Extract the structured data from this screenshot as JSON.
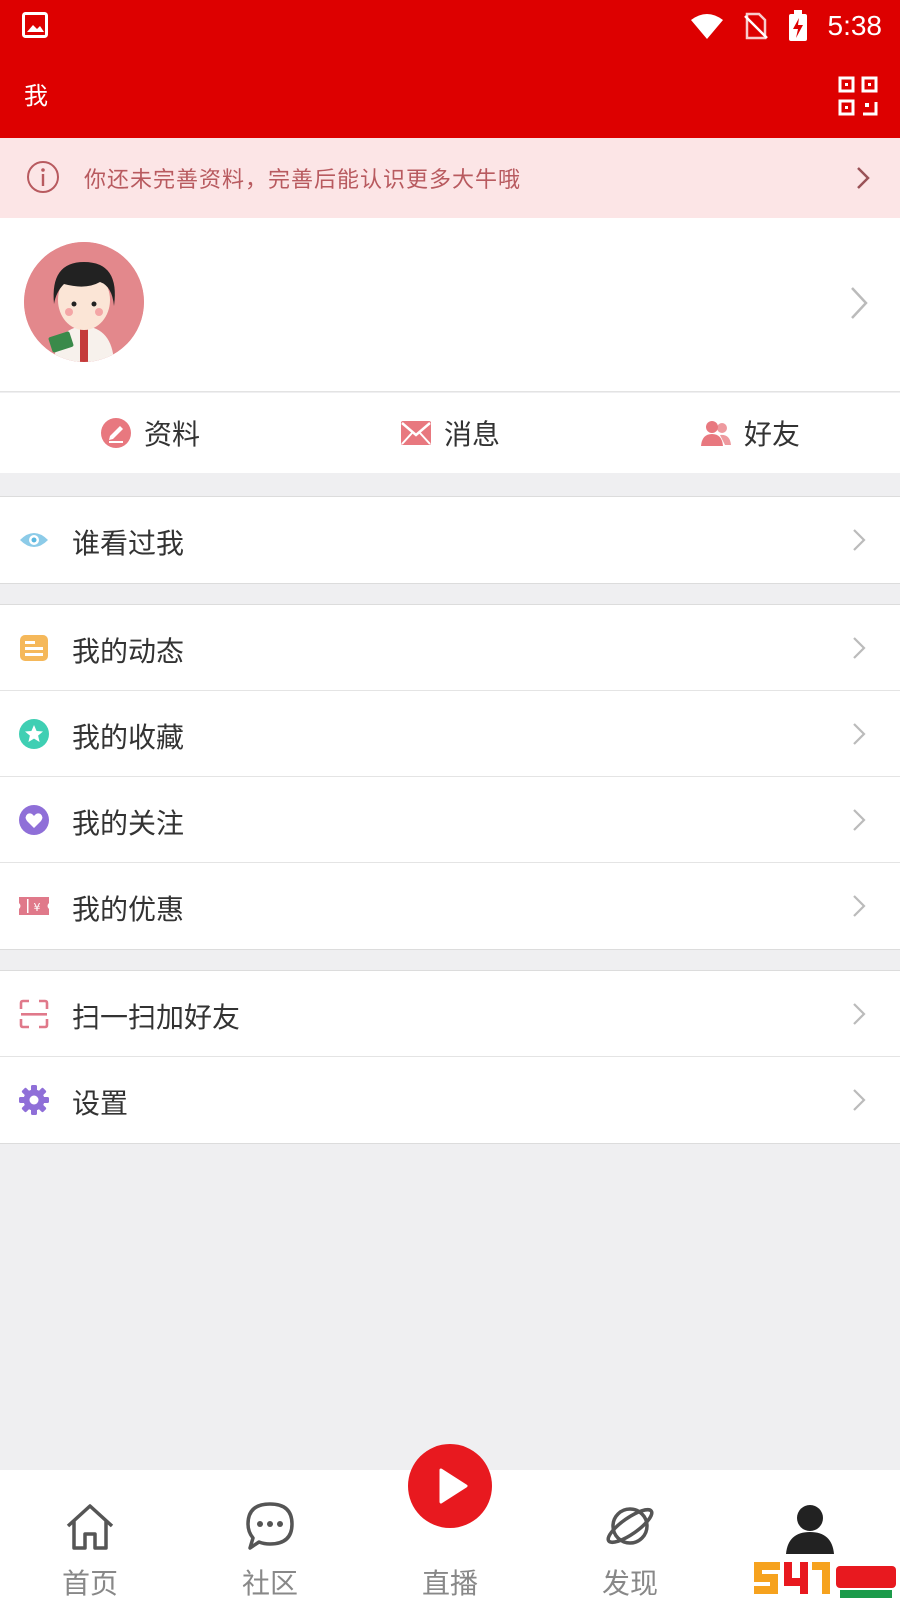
{
  "status_bar": {
    "time": "5:38"
  },
  "header": {
    "title": "我"
  },
  "notice": {
    "text": "你还未完善资料，完善后能认识更多大牛哦"
  },
  "quick_actions": [
    {
      "label": "资料",
      "icon": "edit-icon",
      "color": "#e8787f"
    },
    {
      "label": "消息",
      "icon": "mail-icon",
      "color": "#e8787f"
    },
    {
      "label": "好友",
      "icon": "friends-icon",
      "color": "#e8787f"
    }
  ],
  "menu_groups": [
    [
      {
        "label": "谁看过我",
        "icon": "eye-icon",
        "color": "#5bb8e0"
      }
    ],
    [
      {
        "label": "我的动态",
        "icon": "feed-icon",
        "color": "#f5b85a"
      },
      {
        "label": "我的收藏",
        "icon": "star-icon",
        "color": "#3fcfb3"
      },
      {
        "label": "我的关注",
        "icon": "heart-icon",
        "color": "#8f6fd8"
      },
      {
        "label": "我的优惠",
        "icon": "coupon-icon",
        "color": "#e0798a"
      }
    ],
    [
      {
        "label": "扫一扫加好友",
        "icon": "scan-icon",
        "color": "#e0798a"
      },
      {
        "label": "设置",
        "icon": "gear-icon",
        "color": "#8f6fd8"
      }
    ]
  ],
  "tabbar": [
    {
      "label": "首页",
      "icon": "home-icon"
    },
    {
      "label": "社区",
      "icon": "chat-icon"
    },
    {
      "label": "直播",
      "icon": "play-icon"
    },
    {
      "label": "发现",
      "icon": "planet-icon"
    },
    {
      "label": "",
      "icon": "user-icon"
    }
  ],
  "colors": {
    "brand_red": "#dd0000",
    "notice_bg": "#fce5e6",
    "notice_text": "#b85a5f"
  }
}
